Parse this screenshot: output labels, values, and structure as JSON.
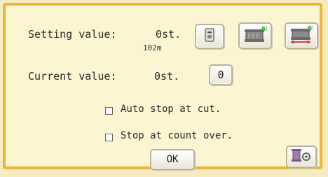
{
  "setting": {
    "label": "Setting value:",
    "value": "0st.",
    "sub_value": "102m"
  },
  "current": {
    "label": "Current value:",
    "value": "0st.",
    "button_value": "0"
  },
  "icons": {
    "set_button": "bobbin-set-icon",
    "counter_button": "spool-counter-icon",
    "counter_reset_button": "spool-counter-reset-icon",
    "settings_button": "thread-settings-icon"
  },
  "options": [
    {
      "label": "Auto stop at cut.",
      "checked": false
    },
    {
      "label": "Stop at count over.",
      "checked": false
    }
  ],
  "ok_label": "OK",
  "colors": {
    "border": "#e8b63a",
    "panel": "#fbf5d2",
    "badge_green": "#2eaa3c",
    "accent_red": "#d64040"
  }
}
